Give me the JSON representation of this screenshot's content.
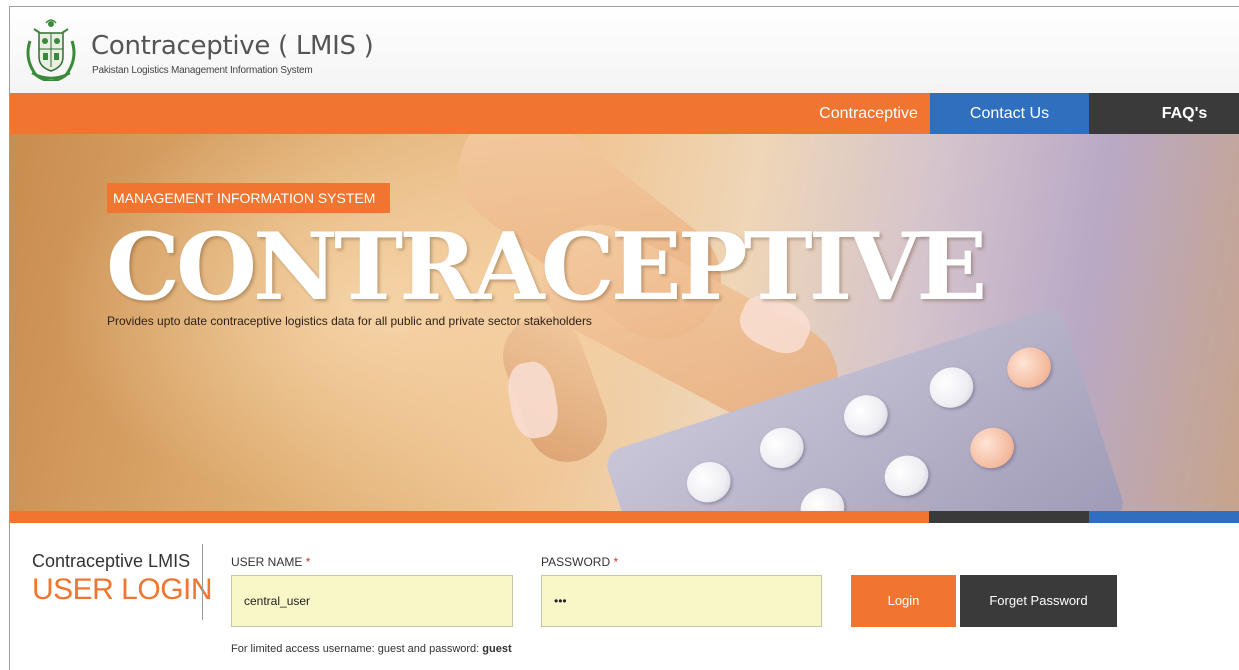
{
  "header": {
    "title": "Contraceptive ( LMIS )",
    "subtitle": "Pakistan Logistics Management Information System",
    "emblem_icon": "pakistan-state-emblem-icon"
  },
  "nav": {
    "items": [
      {
        "label": "Contraceptive"
      },
      {
        "label": "Contact Us"
      },
      {
        "label": "FAQ's"
      }
    ]
  },
  "hero": {
    "tag": "MANAGEMENT INFORMATION SYSTEM",
    "title": "CONTRACEPTIVE",
    "tagline": "Provides upto date contraceptive logistics data for all public and private sector stakeholders"
  },
  "login": {
    "heading_top": "Contraceptive LMIS",
    "heading_main": "USER LOGIN",
    "username_label": "USER NAME",
    "password_label": "PASSWORD",
    "required_mark": "*",
    "username_value": "central_user",
    "password_value": "•••",
    "login_button": "Login",
    "forget_button": "Forget Password",
    "hint_text": "For limited access username: guest and password:",
    "hint_bold": "guest"
  },
  "colors": {
    "accent_orange": "#f07530",
    "nav_blue": "#2f6fbd",
    "nav_dark": "#3a3a3a",
    "input_bg": "#f8f7c7"
  }
}
